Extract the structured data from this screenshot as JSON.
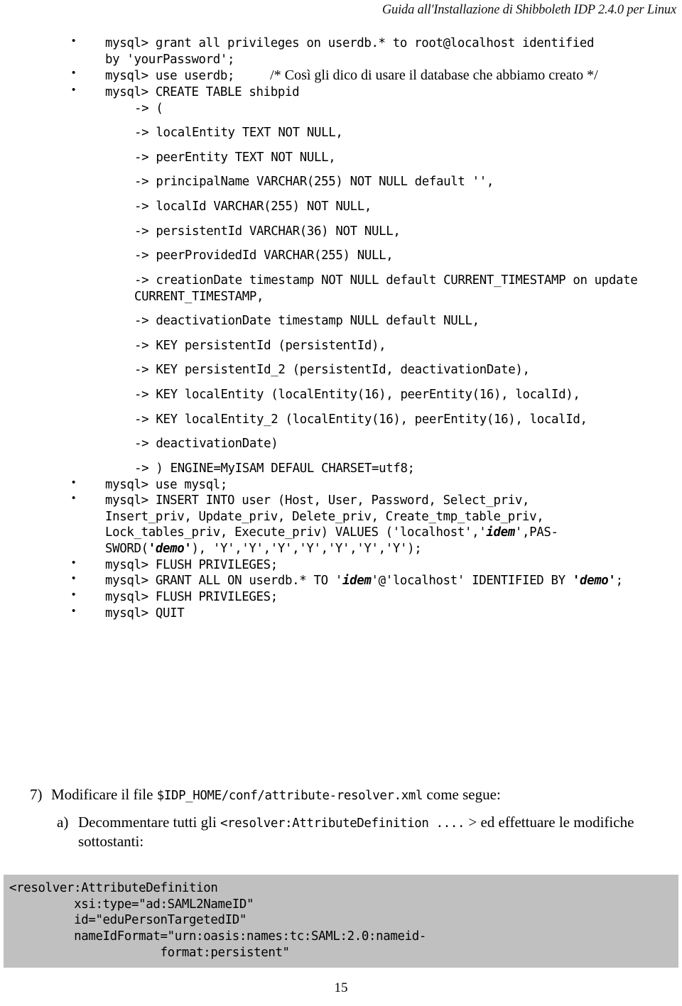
{
  "header": {
    "running_title": "Guida all'Installazione di Shibboleth IDP 2.4.0 per Linux"
  },
  "footer": {
    "page_number": "15"
  },
  "bullets": [
    {
      "id": "grant-privileges",
      "lines": [
        "mysql> grant all privileges on userdb.* to root@localhost identified",
        "by 'yourPassword';"
      ]
    },
    {
      "id": "use-userdb",
      "command": "mysql> use userdb;",
      "comment": "/* Così gli dico di usare il database che abbiamo creato */"
    },
    {
      "id": "create-table-shibpid",
      "command": "mysql> CREATE TABLE shibpid",
      "arrow_lines": [
        "-> (",
        "-> localEntity TEXT NOT NULL,",
        "-> peerEntity TEXT NOT NULL,",
        "-> principalName VARCHAR(255) NOT NULL default '',",
        "-> localId VARCHAR(255) NOT NULL,",
        "-> persistentId VARCHAR(36) NOT NULL,",
        "-> peerProvidedId VARCHAR(255) NULL,",
        "-> creationDate timestamp NOT NULL default CURRENT_TIMESTAMP on update CURRENT_TIMESTAMP,",
        "-> deactivationDate timestamp NULL default NULL,",
        "-> KEY persistentId (persistentId),",
        "-> KEY persistentId_2 (persistentId, deactivationDate),",
        "-> KEY localEntity (localEntity(16), peerEntity(16), localId),",
        "-> KEY localEntity_2 (localEntity(16), peerEntity(16), localId,",
        "-> deactivationDate)",
        "-> ) ENGINE=MyISAM DEFAUL CHARSET=utf8;"
      ]
    },
    {
      "id": "use-mysql",
      "command": "mysql> use mysql;"
    },
    {
      "id": "insert-into-user",
      "segments": [
        {
          "text": "mysql> INSERT INTO user (Host, User, Password, Select_priv,\nInsert_priv, Update_priv, Delete_priv, Create_tmp_table_priv,\nLock_tables_priv, Execute_priv) VALUES ('localhost','",
          "style": "plain"
        },
        {
          "text": "idem",
          "style": "bold-italic"
        },
        {
          "text": "',PAS-\nSWORD(",
          "style": "plain"
        },
        {
          "text": "'demo'",
          "style": "bold-italic"
        },
        {
          "text": "), 'Y','Y','Y','Y','Y','Y','Y');",
          "style": "plain"
        }
      ]
    },
    {
      "id": "flush-privileges-1",
      "command": "mysql> FLUSH PRIVILEGES;"
    },
    {
      "id": "grant-all-userdb",
      "segments": [
        {
          "text": "mysql> GRANT ALL ON userdb.* TO '",
          "style": "plain"
        },
        {
          "text": "idem",
          "style": "bold-italic"
        },
        {
          "text": "'@'localhost' IDENTIFIED BY ",
          "style": "plain"
        },
        {
          "text": "'demo'",
          "style": "bold-italic"
        },
        {
          "text": ";",
          "style": "plain"
        }
      ]
    },
    {
      "id": "flush-privileges-2",
      "command": "mysql> FLUSH PRIVILEGES;"
    },
    {
      "id": "quit",
      "command": "mysql> QUIT"
    }
  ],
  "outline": {
    "step7": {
      "marker": "7)",
      "text_before": "Modificare il file ",
      "code": "$IDP_HOME/conf/attribute-resolver.xml",
      "text_after": " come segue:"
    },
    "stepA": {
      "marker": "a)",
      "text_before": "Decommentare tutti gli ",
      "code": "<resolver:AttributeDefinition ....",
      "text_after": " > ed effettuare le modifiche sottostanti:"
    }
  },
  "codebox": {
    "background": "#c0c0c0",
    "lines": [
      "<resolver:AttributeDefinition",
      "         xsi:type=\"ad:SAML2NameID\"",
      "         id=\"eduPersonTargetedID\"",
      "         nameIdFormat=\"urn:oasis:names:tc:SAML:2.0:nameid-",
      "                     format:persistent\""
    ]
  }
}
